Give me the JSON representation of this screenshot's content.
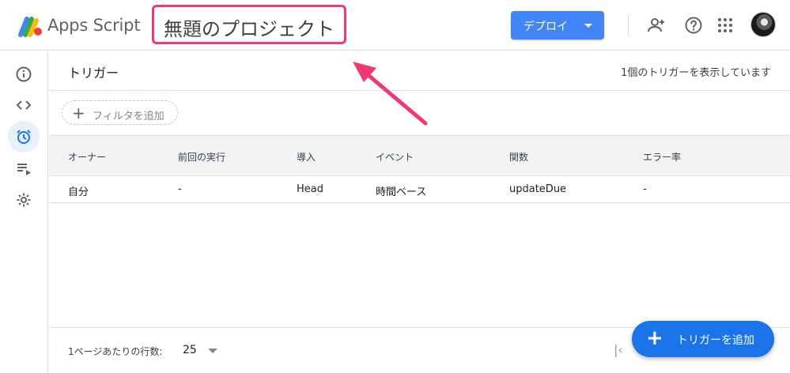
{
  "header": {
    "app_name": "Apps Script",
    "project_title": "無題のプロジェクト",
    "deploy_label": "デプロイ",
    "icons": [
      "add-person-icon",
      "help-icon",
      "apps-grid-icon",
      "avatar"
    ]
  },
  "rail": {
    "items": [
      {
        "name": "overview",
        "icon": "info-icon"
      },
      {
        "name": "editor",
        "icon": "code-icon"
      },
      {
        "name": "triggers",
        "icon": "alarm-clock-icon",
        "active": true
      },
      {
        "name": "executions",
        "icon": "executions-list-icon"
      },
      {
        "name": "settings",
        "icon": "gear-icon"
      }
    ]
  },
  "main": {
    "title": "トリガー",
    "count_text": "1個のトリガーを表示しています",
    "filter_label": "フィルタを追加",
    "columns": [
      "オーナー",
      "前回の実行",
      "導入",
      "イベント",
      "関数",
      "エラー率"
    ],
    "rows": [
      [
        "自分",
        "-",
        "Head",
        "時間ベース",
        "updateDue",
        "-"
      ]
    ],
    "footer": {
      "rows_per_page_label": "1ページあたりの行数:",
      "rows_per_page_value": "25"
    },
    "fab_label": "トリガーを追加"
  },
  "colors": {
    "accent": "#1a73e8",
    "deploy": "#4285f4",
    "highlight": "#f0396f"
  }
}
